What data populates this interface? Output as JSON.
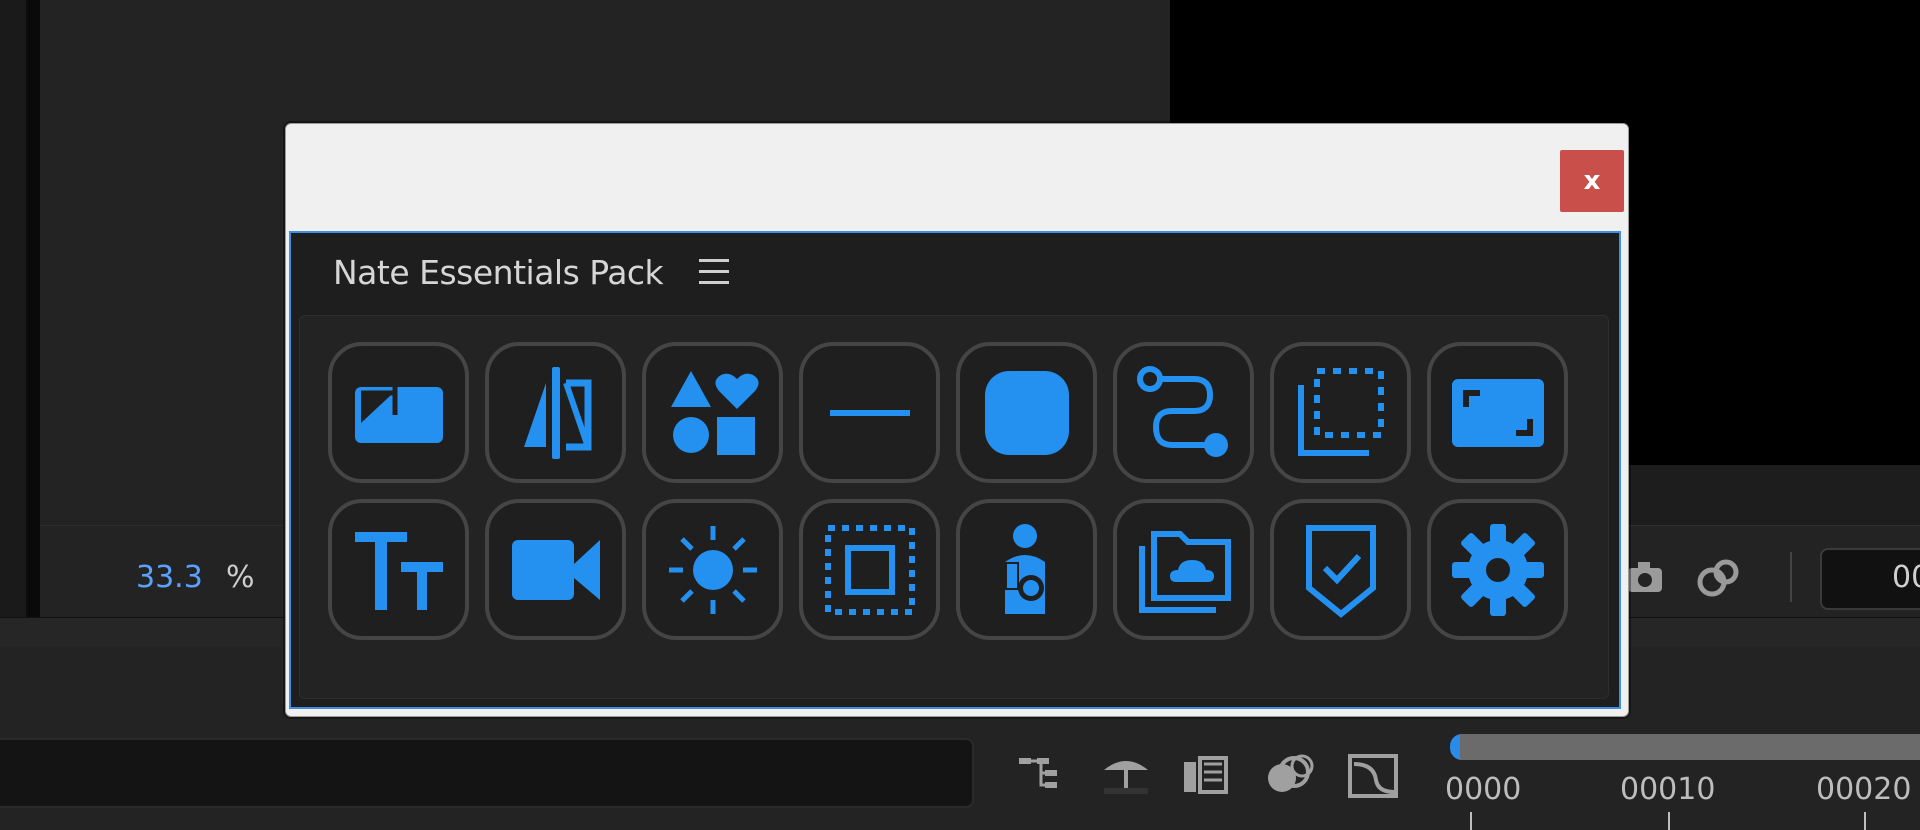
{
  "viewer": {
    "zoom_value": "33.3",
    "zoom_unit": "%",
    "timecode": "00"
  },
  "timeline": {
    "ruler_labels": [
      "0000",
      "00010",
      "00020"
    ]
  },
  "window": {
    "close_label": "x",
    "panel_title": "Nate Essentials Pack",
    "tools": [
      {
        "icon": "split-rectangle-icon"
      },
      {
        "icon": "mirror-flip-icon"
      },
      {
        "icon": "shapes-icon"
      },
      {
        "icon": "line-icon"
      },
      {
        "icon": "rounded-square-icon"
      },
      {
        "icon": "route-path-icon"
      },
      {
        "icon": "dotted-selection-icon"
      },
      {
        "icon": "fullscreen-corners-icon"
      },
      {
        "icon": "text-size-icon"
      },
      {
        "icon": "video-camera-icon"
      },
      {
        "icon": "sun-brightness-icon"
      },
      {
        "icon": "safe-area-icon"
      },
      {
        "icon": "person-icon"
      },
      {
        "icon": "cloud-folder-icon"
      },
      {
        "icon": "shield-check-icon"
      },
      {
        "icon": "gear-icon"
      }
    ]
  },
  "colors": {
    "accent": "#2490f0",
    "close_red": "#c9504a",
    "panel_border": "#3f8fe6"
  }
}
